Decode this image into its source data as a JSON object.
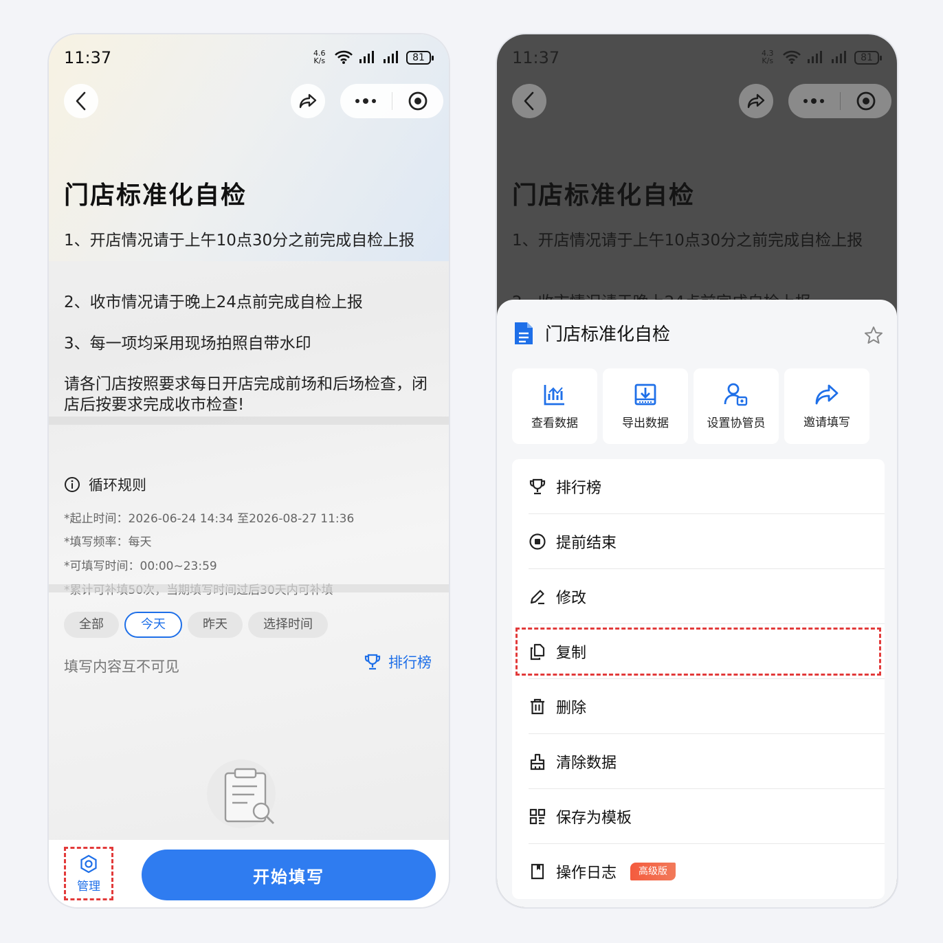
{
  "status": {
    "time": "11:37",
    "speed_left": [
      "4.6",
      "K/s"
    ],
    "speed_right": [
      "4.3",
      "K/s"
    ],
    "battery": "81"
  },
  "page": {
    "title": "门店标准化自检",
    "paragraphs": [
      "1、开店情况请于上午10点30分之前完成自检上报",
      "2、收市情况请于晚上24点前完成自检上报",
      "3、每一项均采用现场拍照自带水印",
      "请各门店按照要求每日开店完成前场和后场检查，闭店后按要求完成收市检查!"
    ]
  },
  "rules": {
    "heading": "循环规则",
    "lines": [
      "*起止时间：2026-06-24 14:34 至2026-08-27 11:36",
      "*填写频率：每天",
      "*可填写时间：00:00~23:59",
      "*累计可补填50次，当期填写时间过后30天内可补填"
    ]
  },
  "filters": {
    "chips": [
      "全部",
      "今天",
      "昨天",
      "选择时间"
    ],
    "active": "今天"
  },
  "fill_note": "填写内容互不可见",
  "rank_link": "排行榜",
  "bottom": {
    "manage_label": "管理",
    "start_label": "开始填写"
  },
  "sheet": {
    "title": "门店标准化自检",
    "actions": [
      {
        "label": "查看数据",
        "icon": "chart-icon"
      },
      {
        "label": "导出数据",
        "icon": "export-icon"
      },
      {
        "label": "设置协管员",
        "icon": "admin-icon"
      },
      {
        "label": "邀请填写",
        "icon": "share-icon"
      }
    ],
    "menu": [
      {
        "label": "排行榜",
        "icon": "trophy-icon"
      },
      {
        "label": "提前结束",
        "icon": "stop-icon"
      },
      {
        "label": "修改",
        "icon": "edit-icon"
      },
      {
        "label": "复制",
        "icon": "copy-icon"
      },
      {
        "label": "删除",
        "icon": "trash-icon"
      },
      {
        "label": "清除数据",
        "icon": "brush-icon"
      },
      {
        "label": "保存为模板",
        "icon": "template-icon"
      },
      {
        "label": "操作日志",
        "icon": "log-icon",
        "badge": "高级版"
      }
    ]
  },
  "colors": {
    "accent": "#2f7cf0",
    "highlight": "#e23a3a",
    "badge": "#f45b3e"
  }
}
